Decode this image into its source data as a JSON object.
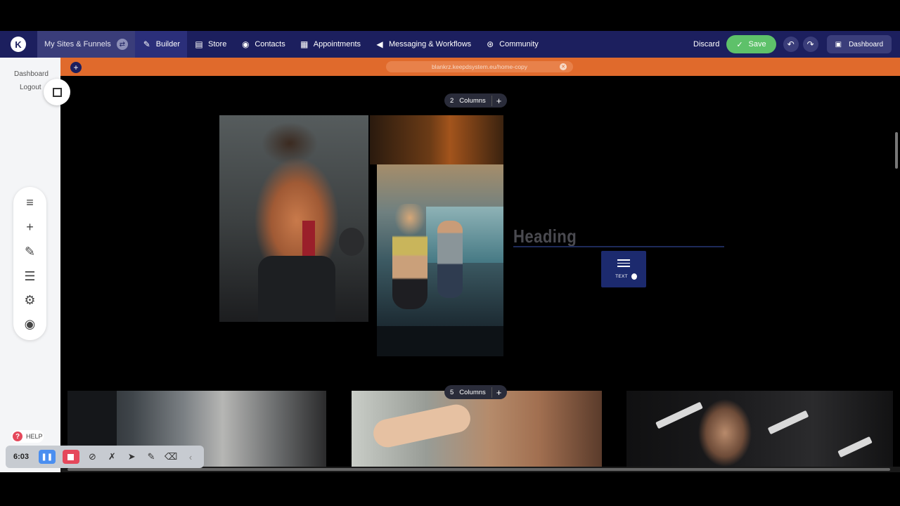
{
  "nav": {
    "logo_letter": "K",
    "sites_label": "My Sites & Funnels",
    "items": [
      {
        "label": "Builder",
        "icon": "brush-icon"
      },
      {
        "label": "Store",
        "icon": "store-icon"
      },
      {
        "label": "Contacts",
        "icon": "contacts-icon"
      },
      {
        "label": "Appointments",
        "icon": "calendar-icon"
      },
      {
        "label": "Messaging & Workflows",
        "icon": "megaphone-icon"
      },
      {
        "label": "Community",
        "icon": "community-icon"
      }
    ],
    "discard_label": "Discard",
    "save_label": "Save",
    "dashboard_label": "Dashboard"
  },
  "sidebar": {
    "dashboard_link": "Dashboard",
    "logout_link": "Logout",
    "help_label": "HELP"
  },
  "url_bar": {
    "url": "blankrz.keepdsystem.eu/home-copy"
  },
  "canvas": {
    "row1_columns": {
      "count": "2",
      "label": "Columns"
    },
    "row2_columns": {
      "count": "5",
      "label": "Columns"
    },
    "heading_text": "Heading",
    "drag_element_label": "TEXT"
  },
  "recorder": {
    "time": "6:03"
  },
  "colors": {
    "nav_bg": "#1c1f5e",
    "url_bar_bg": "#e06a2c",
    "save_green": "#5ec16a",
    "canvas_bg": "#000000"
  }
}
